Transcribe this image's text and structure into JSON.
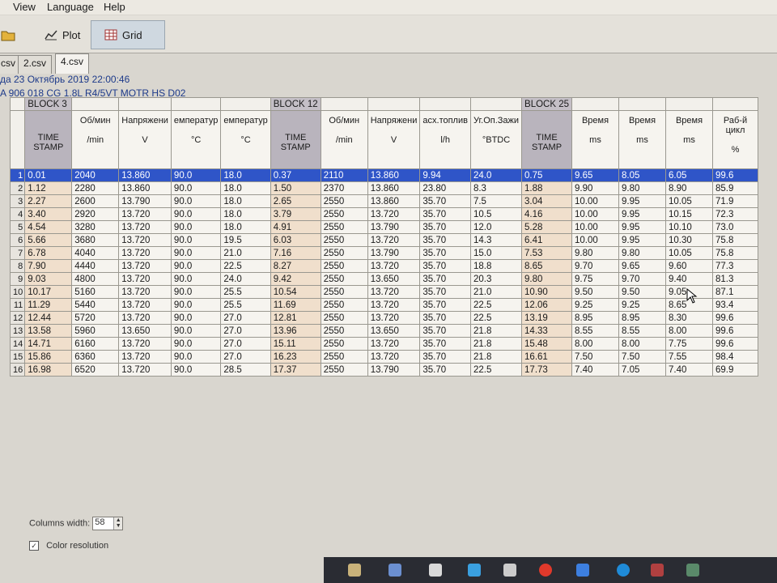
{
  "menu": {
    "view": "View",
    "language": "Language",
    "help": "Help"
  },
  "toolbar": {
    "plot": "Plot",
    "grid": "Grid"
  },
  "tabs": [
    "csv",
    "2.csv",
    "4.csv"
  ],
  "info": {
    "line1": "да 23 Октябрь 2019 22:00:46",
    "line2": "A 906 018 CG  1.8L R4/5VT MOTR HS D02"
  },
  "grid": {
    "blocks": {
      "b3": "BLOCK 3",
      "b12": "BLOCK 12",
      "b25": "BLOCK 25"
    },
    "headers": [
      {
        "name": "TIME STAMP",
        "unit": ""
      },
      {
        "name": "Об/мин",
        "unit": "/min"
      },
      {
        "name": "Напряжени",
        "unit": "V"
      },
      {
        "name": "емператур",
        "unit": "°C"
      },
      {
        "name": "емператур",
        "unit": "°C"
      },
      {
        "name": "TIME STAMP",
        "unit": ""
      },
      {
        "name": "Об/мин",
        "unit": "/min"
      },
      {
        "name": "Напряжени",
        "unit": "V"
      },
      {
        "name": "асх.топлив",
        "unit": "l/h"
      },
      {
        "name": "Уг.Оп.Зажи",
        "unit": "°BTDC"
      },
      {
        "name": "TIME STAMP",
        "unit": ""
      },
      {
        "name": "Время",
        "unit": "ms"
      },
      {
        "name": "Время",
        "unit": "ms"
      },
      {
        "name": "Время",
        "unit": "ms"
      },
      {
        "name": "Раб-й цикл",
        "unit": "%"
      }
    ],
    "rows": [
      [
        "0.01",
        "2040",
        "13.860",
        "90.0",
        "18.0",
        "0.37",
        "2110",
        "13.860",
        "9.94",
        "24.0",
        "0.75",
        "9.65",
        "8.05",
        "6.05",
        "99.6"
      ],
      [
        "1.12",
        "2280",
        "13.860",
        "90.0",
        "18.0",
        "1.50",
        "2370",
        "13.860",
        "23.80",
        "8.3",
        "1.88",
        "9.90",
        "9.80",
        "8.90",
        "85.9"
      ],
      [
        "2.27",
        "2600",
        "13.790",
        "90.0",
        "18.0",
        "2.65",
        "2550",
        "13.860",
        "35.70",
        "7.5",
        "3.04",
        "10.00",
        "9.95",
        "10.05",
        "71.9"
      ],
      [
        "3.40",
        "2920",
        "13.720",
        "90.0",
        "18.0",
        "3.79",
        "2550",
        "13.720",
        "35.70",
        "10.5",
        "4.16",
        "10.00",
        "9.95",
        "10.15",
        "72.3"
      ],
      [
        "4.54",
        "3280",
        "13.720",
        "90.0",
        "18.0",
        "4.91",
        "2550",
        "13.790",
        "35.70",
        "12.0",
        "5.28",
        "10.00",
        "9.95",
        "10.10",
        "73.0"
      ],
      [
        "5.66",
        "3680",
        "13.720",
        "90.0",
        "19.5",
        "6.03",
        "2550",
        "13.720",
        "35.70",
        "14.3",
        "6.41",
        "10.00",
        "9.95",
        "10.30",
        "75.8"
      ],
      [
        "6.78",
        "4040",
        "13.720",
        "90.0",
        "21.0",
        "7.16",
        "2550",
        "13.790",
        "35.70",
        "15.0",
        "7.53",
        "9.80",
        "9.80",
        "10.05",
        "75.8"
      ],
      [
        "7.90",
        "4440",
        "13.720",
        "90.0",
        "22.5",
        "8.27",
        "2550",
        "13.720",
        "35.70",
        "18.8",
        "8.65",
        "9.70",
        "9.65",
        "9.60",
        "77.3"
      ],
      [
        "9.03",
        "4800",
        "13.720",
        "90.0",
        "24.0",
        "9.42",
        "2550",
        "13.650",
        "35.70",
        "20.3",
        "9.80",
        "9.75",
        "9.70",
        "9.40",
        "81.3"
      ],
      [
        "10.17",
        "5160",
        "13.720",
        "90.0",
        "25.5",
        "10.54",
        "2550",
        "13.720",
        "35.70",
        "21.0",
        "10.90",
        "9.50",
        "9.50",
        "9.05",
        "87.1"
      ],
      [
        "11.29",
        "5440",
        "13.720",
        "90.0",
        "25.5",
        "11.69",
        "2550",
        "13.720",
        "35.70",
        "22.5",
        "12.06",
        "9.25",
        "9.25",
        "8.65",
        "93.4"
      ],
      [
        "12.44",
        "5720",
        "13.720",
        "90.0",
        "27.0",
        "12.81",
        "2550",
        "13.720",
        "35.70",
        "22.5",
        "13.19",
        "8.95",
        "8.95",
        "8.30",
        "99.6"
      ],
      [
        "13.58",
        "5960",
        "13.650",
        "90.0",
        "27.0",
        "13.96",
        "2550",
        "13.650",
        "35.70",
        "21.8",
        "14.33",
        "8.55",
        "8.55",
        "8.00",
        "99.6"
      ],
      [
        "14.71",
        "6160",
        "13.720",
        "90.0",
        "27.0",
        "15.11",
        "2550",
        "13.720",
        "35.70",
        "21.8",
        "15.48",
        "8.00",
        "8.00",
        "7.75",
        "99.6"
      ],
      [
        "15.86",
        "6360",
        "13.720",
        "90.0",
        "27.0",
        "16.23",
        "2550",
        "13.720",
        "35.70",
        "21.8",
        "16.61",
        "7.50",
        "7.50",
        "7.55",
        "98.4"
      ],
      [
        "16.98",
        "6520",
        "13.720",
        "90.0",
        "28.5",
        "17.37",
        "2550",
        "13.790",
        "35.70",
        "22.5",
        "17.73",
        "7.40",
        "7.05",
        "7.40",
        "69.9"
      ]
    ]
  },
  "controls": {
    "columns_width_label": "Columns width:",
    "columns_width_value": "58",
    "color_resolution": "Color resolution"
  },
  "colors": {
    "selection": "#2f55c8",
    "timestamp_col": "#f0dfcc",
    "header_block": "#c4bfc6"
  }
}
